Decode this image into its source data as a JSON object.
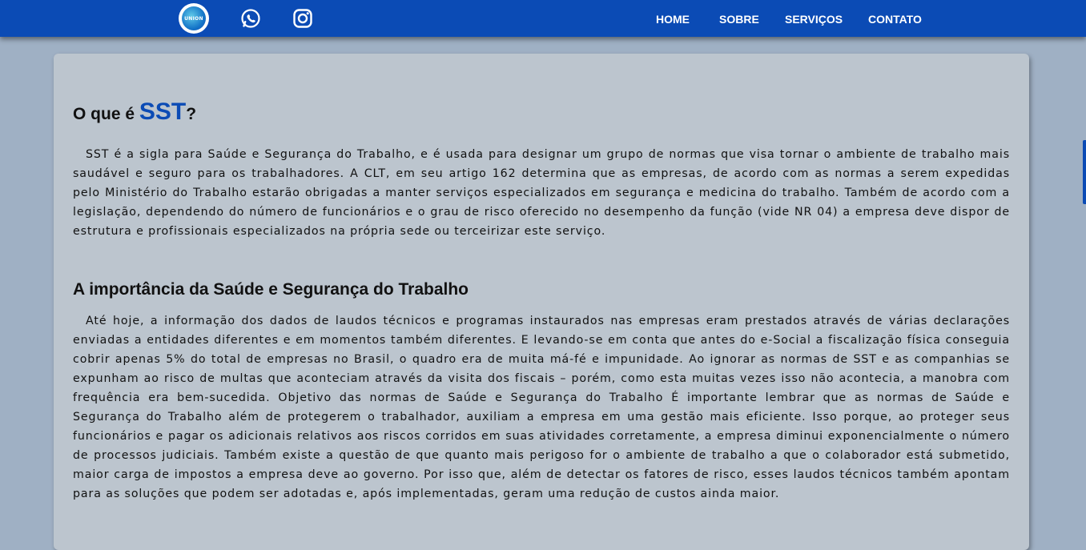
{
  "header": {
    "logo_text": "UNION",
    "nav": {
      "home": "HOME",
      "sobre": "SOBRE",
      "servicos": "SERVIÇOS",
      "contato": "CONTATO"
    }
  },
  "section1": {
    "title_prefix": "O que é ",
    "title_accent": "SST",
    "title_suffix": "?",
    "body": "SST é a sigla para Saúde e Segurança do Trabalho, e é usada para designar um grupo de normas que visa tornar o ambiente de trabalho mais saudável e seguro para os trabalhadores. A CLT, em seu artigo 162 determina que as empresas, de acordo com as normas a serem expedidas pelo Ministério do Trabalho estarão obrigadas a manter serviços especializados em segurança e medicina do trabalho. Também de acordo com a legislação, dependendo do número de funcionários e o grau de risco oferecido no desempenho da função (vide NR 04) a empresa deve dispor de estrutura e profissionais especializados na própria sede ou terceirizar este serviço."
  },
  "section2": {
    "title": "A importância da Saúde e Segurança do Trabalho",
    "body": "Até hoje, a informação dos dados de laudos técnicos e programas instaurados nas empresas eram prestados através de várias declarações enviadas a entidades diferentes e em momentos também diferentes. E levando-se em conta que antes do e-Social a fiscalização física conseguia cobrir apenas 5% do total de empresas no Brasil, o quadro era de muita má-fé e impunidade. Ao ignorar as normas de SST e as companhias se expunham ao risco de multas que aconteciam através da visita dos fiscais – porém, como esta muitas vezes isso não acontecia, a manobra com frequência era bem-sucedida. Objetivo das normas de Saúde e Segurança do Trabalho É importante lembrar que as normas de Saúde e Segurança do Trabalho além de protegerem o trabalhador, auxiliam a empresa em uma gestão mais eficiente. Isso porque, ao proteger seus funcionários e pagar os adicionais relativos aos riscos corridos em suas atividades corretamente, a empresa diminui exponencialmente o número de processos judiciais. Também existe a questão de que quanto mais perigoso for o ambiente de trabalho a que o colaborador está submetido, maior carga de impostos a empresa deve ao governo. Por isso que, além de detectar os fatores de risco, esses laudos técnicos também apontam para as soluções que podem ser adotadas e, após implementadas, geram uma redução de custos ainda maior."
  },
  "icons": {
    "whatsapp": "whatsapp-icon",
    "instagram": "instagram-icon"
  },
  "colors": {
    "header_bg": "#0b4bb5",
    "page_bg": "#9fb0c4",
    "card_bg": "#bcc5ce",
    "accent": "#0b4bb5"
  }
}
